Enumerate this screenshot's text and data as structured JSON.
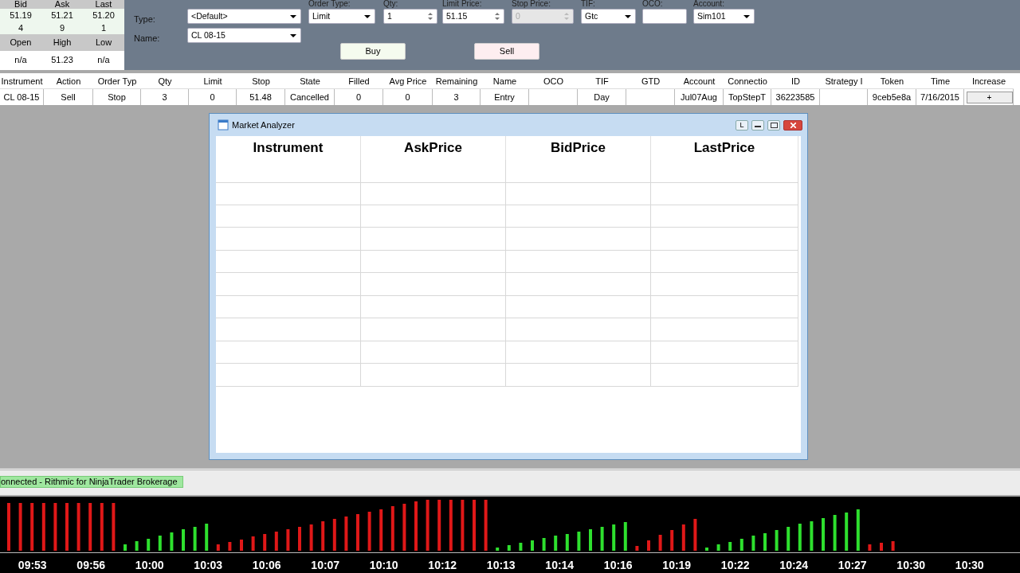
{
  "quote": {
    "headers": [
      "Bid",
      "Ask",
      "Last"
    ],
    "prices": [
      "51.19",
      "51.21",
      "51.20"
    ],
    "sizes": [
      "4",
      "9",
      "1"
    ],
    "stats_headers": [
      "Open",
      "High",
      "Low"
    ],
    "stats": [
      "n/a",
      "51.23",
      "n/a"
    ]
  },
  "order_form": {
    "type_label": "Type:",
    "type_value": "<Default>",
    "name_label": "Name:",
    "name_value": "CL 08-15",
    "fields": [
      {
        "label": "Order Type:",
        "kind": "dropdown",
        "value": "Limit",
        "disabled": false
      },
      {
        "label": "Qty:",
        "kind": "spinner",
        "value": "1",
        "disabled": false
      },
      {
        "label": "Limit Price:",
        "kind": "spinner",
        "value": "51.15",
        "disabled": false
      },
      {
        "label": "Stop Price:",
        "kind": "spinner",
        "value": "0",
        "disabled": true
      },
      {
        "label": "TIF:",
        "kind": "dropdown",
        "value": "Gtc",
        "disabled": false
      },
      {
        "label": "OCO:",
        "kind": "text",
        "disabled": false
      },
      {
        "label": "Account:",
        "kind": "dropdown",
        "value": "Sim101",
        "disabled": false
      }
    ],
    "buttons": [
      {
        "label": "Buy",
        "kind": "buy"
      },
      {
        "label": "Sell",
        "kind": "sell"
      }
    ]
  },
  "orders": {
    "columns": [
      "Instrument",
      "Action",
      "Order Typ",
      "Qty",
      "Limit",
      "Stop",
      "State",
      "Filled",
      "Avg Price",
      "Remaining",
      "Name",
      "OCO",
      "TIF",
      "GTD",
      "Account",
      "Connectio",
      "ID",
      "Strategy I",
      "Token",
      "Time",
      "Increase"
    ],
    "rows": [
      {
        "cells": [
          "CL 08-15",
          "Sell",
          "Stop",
          "3",
          "0",
          "51.48",
          "Cancelled",
          "0",
          "0",
          "3",
          "Entry",
          "",
          "Day",
          "",
          "Jul07Aug",
          "TopStepT",
          "36223585",
          "",
          "9ceb5e8a",
          "7/16/2015"
        ],
        "increase_button": "+"
      }
    ]
  },
  "market_analyzer": {
    "title": "Market Analyzer",
    "title_button": "L",
    "columns": [
      "Instrument",
      "AskPrice",
      "BidPrice",
      "LastPrice"
    ]
  },
  "status_bar": {
    "text": "onnected - Rithmic for NinjaTrader Brokerage"
  },
  "time_axis": {
    "labels": [
      "09:53",
      "09:56",
      "10:00",
      "10:03",
      "10:06",
      "10:07",
      "10:10",
      "10:12",
      "10:13",
      "10:14",
      "10:16",
      "10:19",
      "10:22",
      "10:24",
      "10:27",
      "10:30",
      "10:30"
    ]
  }
}
